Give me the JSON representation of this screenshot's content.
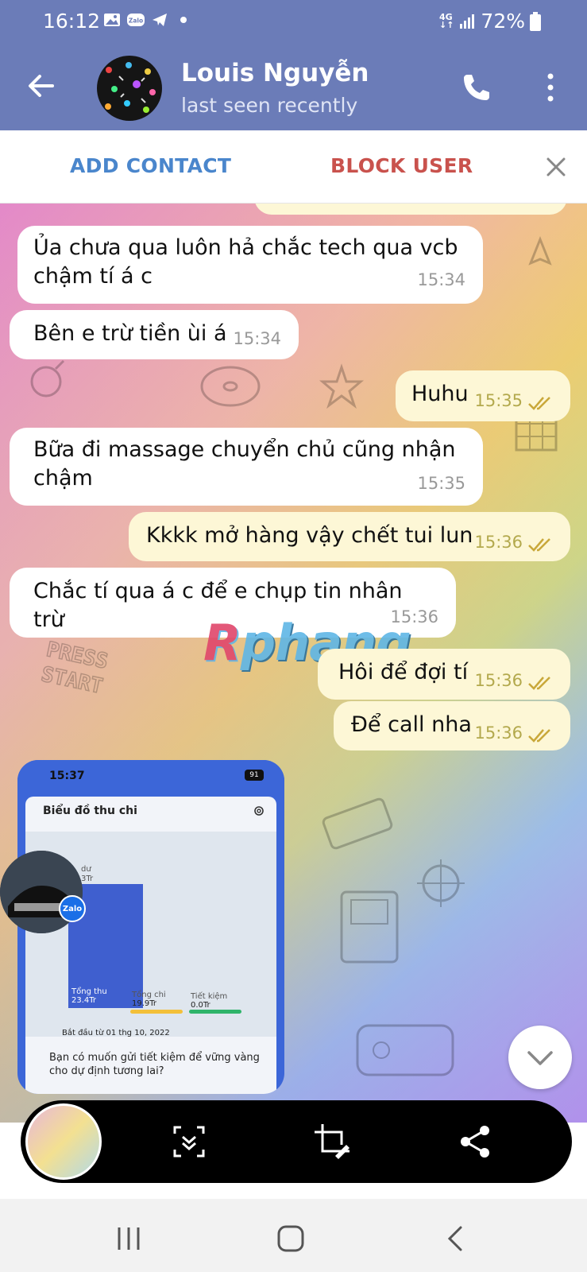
{
  "status_bar": {
    "time": "16:12",
    "network": "4G",
    "battery": "72%",
    "zalo_label": "Zalo"
  },
  "header": {
    "contact_name": "Louis Nguyễn",
    "contact_status": "last seen recently"
  },
  "action_bar": {
    "add_contact": "ADD CONTACT",
    "block_user": "BLOCK USER"
  },
  "messages": [
    {
      "direction": "in",
      "text_line1": "Ủa chưa qua luôn hả chắc tech qua vcb",
      "text_line2": "chậm tí á c",
      "time": "15:34"
    },
    {
      "direction": "in",
      "text": "Bên e trừ tiền ùi á",
      "time": "15:34"
    },
    {
      "direction": "out",
      "text": "Huhu",
      "time": "15:35"
    },
    {
      "direction": "in",
      "text_line1": "Bữa đi massage chuyển chủ cũng nhận",
      "text_line2": "chậm",
      "time": "15:35"
    },
    {
      "direction": "out",
      "text": "Kkkk mở hàng vậy chết tui lun",
      "time": "15:36"
    },
    {
      "direction": "in",
      "text": "Chắc tí qua á c để e chụp tin nhân trừ",
      "time": "15:36"
    },
    {
      "direction": "out",
      "text": "Hôi để đợi tí",
      "time": "15:36"
    },
    {
      "direction": "out",
      "text": "Để call nha",
      "time": "15:36"
    }
  ],
  "watermark": {
    "first": "R",
    "rest": "phang"
  },
  "image_message": {
    "status_time": "15:37",
    "battery": "91",
    "title": "Biểu đồ thu chi",
    "bar_top_label": "dư",
    "bar_top_value": "3Tr",
    "income_label": "Tổng thu",
    "income_value": "23.4Tr",
    "spend_label": "Tổng chi",
    "spend_value": "19.9Tr",
    "save_label": "Tiết kiệm",
    "save_value": "0.0Tr",
    "since": "Bắt đầu từ 01 thg 10, 2022",
    "question": "Bạn có muốn gửi tiết kiệm để vững vàng cho dự định tương lai?",
    "badge": "Zalo"
  },
  "colors": {
    "header": "#6b7cb8",
    "add_contact": "#4a86cc",
    "block_user": "#c9524d",
    "outgoing_bubble": "#fdf7d6",
    "incoming_bubble": "#ffffff"
  }
}
